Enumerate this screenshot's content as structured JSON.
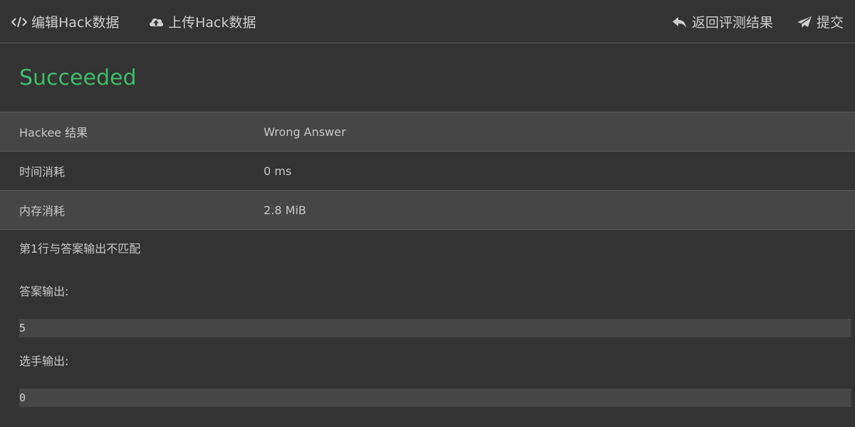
{
  "toolbar": {
    "edit_label": "编辑Hack数据",
    "upload_label": "上传Hack数据",
    "back_label": "返回评测结果",
    "submit_label": "提交"
  },
  "status": {
    "text": "Succeeded",
    "color": "#3ebc6a"
  },
  "info": {
    "rows": [
      {
        "key": "Hackee 结果",
        "value": "Wrong Answer"
      },
      {
        "key": "时间消耗",
        "value": "0 ms"
      },
      {
        "key": "内存消耗",
        "value": "2.8 MiB"
      }
    ]
  },
  "details": {
    "message": "第1行与答案输出不匹配",
    "answer_label": "答案输出:",
    "answer_output": "5",
    "player_label": "选手输出:",
    "player_output": "0"
  },
  "icons": {
    "edit": "code-icon",
    "upload": "cloud-upload-icon",
    "back": "reply-icon",
    "submit": "paper-plane-icon"
  }
}
